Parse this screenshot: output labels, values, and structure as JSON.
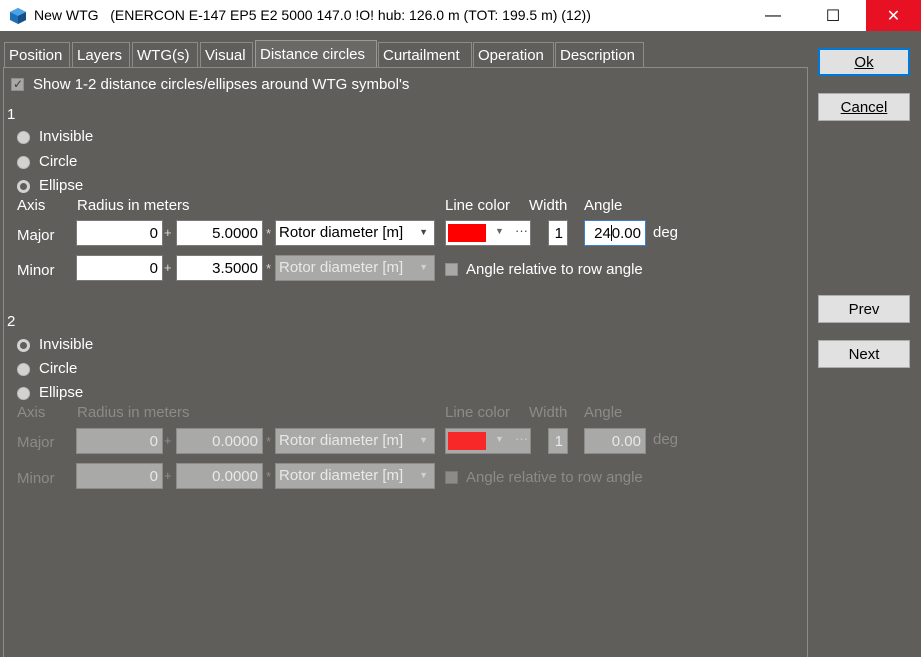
{
  "window": {
    "app": "New WTG",
    "subtitle": "(ENERCON E-147 EP5 E2 5000 147.0 !O! hub: 126.0 m (TOT: 199.5 m) (12))",
    "minimize": "—",
    "maximize": "☐",
    "close": "✕"
  },
  "tabs": [
    "Position",
    "Layers",
    "WTG(s)",
    "Visual",
    "Distance circles",
    "Curtailment",
    "Operation",
    "Description"
  ],
  "buttons": {
    "ok": "Ok",
    "cancel": "Cancel",
    "prev": "Prev",
    "next": "Next"
  },
  "show_circles": {
    "label": "Show 1-2 distance circles/ellipses around WTG symbol's",
    "checked": true
  },
  "headers": {
    "axis": "Axis",
    "radius": "Radius in meters",
    "line_color": "Line color",
    "width": "Width",
    "angle": "Angle"
  },
  "symbols": {
    "plus": "+",
    "star": "*",
    "ellipsis": "···",
    "arrow": "▼",
    "check": "✓"
  },
  "group1": {
    "number": "1",
    "options": [
      "Invisible",
      "Circle",
      "Ellipse"
    ],
    "selected": "Ellipse",
    "major": {
      "label": "Major",
      "offset": "0",
      "factor": "5.0000",
      "unit": "Rotor diameter [m]",
      "width": "1",
      "angle_pre": "24",
      "angle_post": "0.00",
      "deg": "deg"
    },
    "minor": {
      "label": "Minor",
      "offset": "0",
      "factor": "3.5000",
      "unit": "Rotor diameter [m]"
    },
    "relative_label": "Angle relative to row angle",
    "color": "#ff0000"
  },
  "group2": {
    "number": "2",
    "options": [
      "Invisible",
      "Circle",
      "Ellipse"
    ],
    "selected": "Invisible",
    "major": {
      "label": "Major",
      "offset": "0",
      "factor": "0.0000",
      "unit": "Rotor diameter [m]",
      "width": "1",
      "angle": "0.00",
      "deg": "deg"
    },
    "minor": {
      "label": "Minor",
      "offset": "0",
      "factor": "0.0000",
      "unit": "Rotor diameter [m]"
    },
    "relative_label": "Angle relative to row angle",
    "color": "#ff0000"
  }
}
